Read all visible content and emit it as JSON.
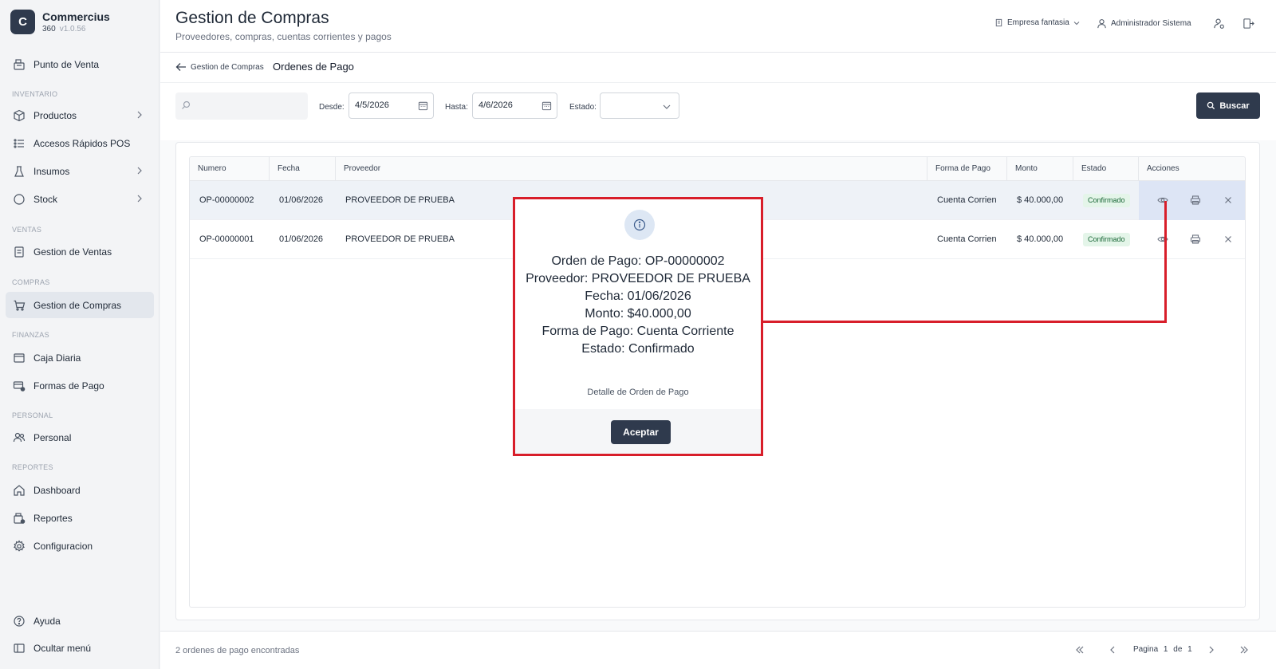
{
  "app": {
    "logo_letter": "C",
    "name": "Commercius",
    "product": "360",
    "version": "v1.0.56"
  },
  "sidebar": {
    "top_item": "Punto de Venta",
    "sections": {
      "inventario": "INVENTARIO",
      "ventas": "VENTAS",
      "compras": "COMPRAS",
      "finanzas": "FINANZAS",
      "personal": "PERSONAL",
      "reportes": "REPORTES"
    },
    "items": {
      "productos": "Productos",
      "accesos": "Accesos Rápidos POS",
      "insumos": "Insumos",
      "stock": "Stock",
      "gestion_ventas": "Gestion de Ventas",
      "gestion_compras": "Gestion de Compras",
      "caja_diaria": "Caja Diaria",
      "formas_pago": "Formas de Pago",
      "personal": "Personal",
      "dashboard": "Dashboard",
      "reportes": "Reportes",
      "configuracion": "Configuracion"
    },
    "bottom": {
      "ayuda": "Ayuda",
      "ocultar": "Ocultar menú"
    }
  },
  "header": {
    "title": "Gestion de Compras",
    "subtitle": "Proveedores, compras, cuentas corrientes y pagos",
    "company": "Empresa fantasia",
    "user": "Administrador Sistema"
  },
  "breadcrumb": {
    "back_label": "Gestion de Compras",
    "current": "Ordenes de Pago"
  },
  "filters": {
    "search_placeholder": "",
    "desde_label": "Desde:",
    "desde_value": "4/5/2026",
    "hasta_label": "Hasta:",
    "hasta_value": "4/6/2026",
    "estado_label": "Estado:",
    "estado_value": "",
    "search_button": "Buscar"
  },
  "table": {
    "columns": {
      "numero": "Numero",
      "fecha": "Fecha",
      "proveedor": "Proveedor",
      "forma_pago": "Forma de Pago",
      "monto": "Monto",
      "estado": "Estado",
      "acciones": "Acciones"
    },
    "rows": [
      {
        "numero": "OP-00000002",
        "fecha": "01/06/2026",
        "proveedor": "PROVEEDOR DE PRUEBA",
        "forma_pago": "Cuenta Corrien",
        "monto": "$ 40.000,00",
        "estado": "Confirmado"
      },
      {
        "numero": "OP-00000001",
        "fecha": "01/06/2026",
        "proveedor": "PROVEEDOR DE PRUEBA",
        "forma_pago": "Cuenta Corrien",
        "monto": "$ 40.000,00",
        "estado": "Confirmado"
      }
    ]
  },
  "footer": {
    "count_text": "2 ordenes de pago encontradas",
    "page_label": "Pagina",
    "page_current": "1",
    "page_of": "de",
    "page_total": "1"
  },
  "modal": {
    "lines": [
      "Orden de Pago: OP-00000002",
      "Proveedor: PROVEEDOR DE PRUEBA",
      "Fecha: 01/06/2026",
      "Monto: $40.000,00",
      "Forma de Pago: Cuenta Corriente",
      "Estado: Confirmado"
    ],
    "caption": "Detalle de Orden de Pago",
    "accept_button": "Aceptar"
  },
  "colors": {
    "primary": "#2f3a4d",
    "highlight_border": "#d81e2a",
    "badge_bg": "#e4f5e9",
    "badge_text": "#166534"
  }
}
